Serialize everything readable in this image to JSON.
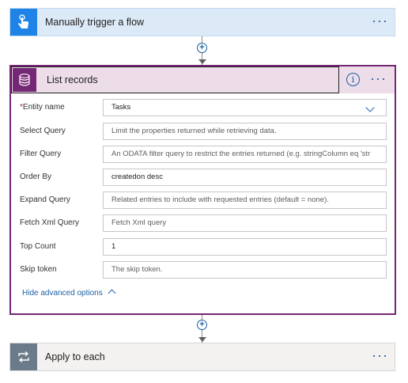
{
  "trigger": {
    "title": "Manually trigger a flow",
    "more": "···",
    "icon": "hand-touch-icon",
    "color": "#1e82e6"
  },
  "list_records": {
    "title": "List records",
    "icon": "database-icon",
    "color": "#742774",
    "info": "i",
    "more": "···",
    "fields": [
      {
        "label": "Entity name",
        "required": true,
        "value": "Tasks",
        "placeholder": "",
        "type": "dropdown"
      },
      {
        "label": "Select Query",
        "required": false,
        "value": "",
        "placeholder": "Limit the properties returned while retrieving data."
      },
      {
        "label": "Filter Query",
        "required": false,
        "value": "",
        "placeholder": "An ODATA filter query to restrict the entries returned (e.g. stringColumn eq 'str"
      },
      {
        "label": "Order By",
        "required": false,
        "value": "createdon desc",
        "placeholder": ""
      },
      {
        "label": "Expand Query",
        "required": false,
        "value": "",
        "placeholder": "Related entries to include with requested entries (default = none)."
      },
      {
        "label": "Fetch Xml Query",
        "required": false,
        "value": "",
        "placeholder": "Fetch Xml query"
      },
      {
        "label": "Top Count",
        "required": false,
        "value": "1",
        "placeholder": ""
      },
      {
        "label": "Skip token",
        "required": false,
        "value": "",
        "placeholder": "The skip token."
      }
    ],
    "advanced_toggle": "Hide advanced options"
  },
  "apply": {
    "title": "Apply to each",
    "more": "···",
    "icon": "loop-icon",
    "color": "#6b7b8a"
  },
  "connectors": {
    "plus": "+"
  }
}
